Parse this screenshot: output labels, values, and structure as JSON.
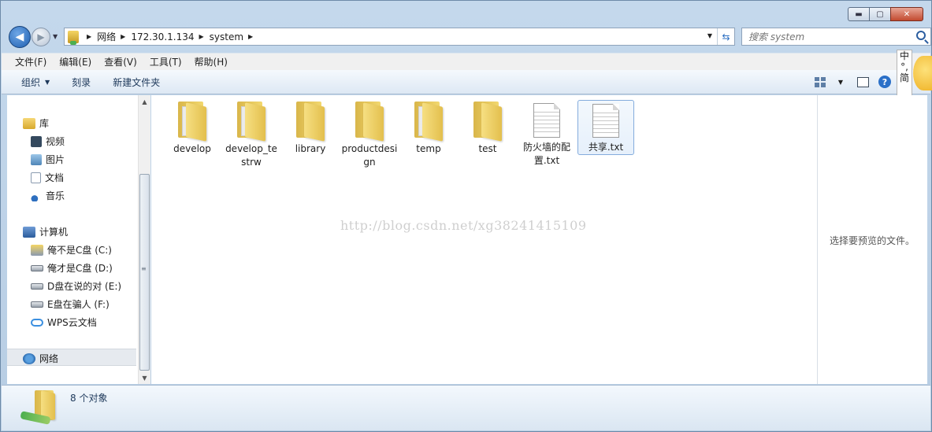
{
  "window": {
    "caption": {
      "minimize": "▬",
      "maximize": "▢",
      "close": "✕"
    }
  },
  "nav": {
    "back_glyph": "◀",
    "forward_glyph": "▶",
    "address": {
      "crumbs": [
        "网络",
        "172.30.1.134",
        "system"
      ],
      "separator": "▶",
      "dropdown": "▼",
      "refresh_glyph": "⇆"
    },
    "search": {
      "placeholder": "搜索 system"
    }
  },
  "menubar": {
    "items": [
      "文件(F)",
      "编辑(E)",
      "查看(V)",
      "工具(T)",
      "帮助(H)"
    ]
  },
  "toolbar": {
    "organize": "组织",
    "burn": "刻录",
    "new_folder": "新建文件夹",
    "dropdown": "▼",
    "help": "?"
  },
  "ime": {
    "chars": [
      "中",
      "°,",
      "简"
    ]
  },
  "navpane": {
    "library": {
      "label": "库",
      "items": [
        "视频",
        "图片",
        "文档",
        "音乐"
      ]
    },
    "computer": {
      "label": "计算机",
      "items": [
        "俺不是C盘 (C:)",
        "俺才是C盘 (D:)",
        "D盘在说的对 (E:)",
        "E盘在骗人 (F:)",
        "WPS云文档"
      ]
    },
    "network": {
      "label": "网络"
    }
  },
  "scroll": {
    "up": "▲",
    "down": "▼",
    "grip": "≡"
  },
  "files": [
    {
      "name": "develop",
      "type": "folder"
    },
    {
      "name": "develop_testrw",
      "type": "folder"
    },
    {
      "name": "library",
      "type": "folder"
    },
    {
      "name": "productdesign",
      "type": "folder"
    },
    {
      "name": "temp",
      "type": "folder"
    },
    {
      "name": "test",
      "type": "folder"
    },
    {
      "name": "防火墙的配置.txt",
      "type": "txt"
    },
    {
      "name": "共享.txt",
      "type": "txt",
      "selected": true
    }
  ],
  "watermark": "http://blog.csdn.net/xg38241415109",
  "preview": {
    "message": "选择要预览的文件。"
  },
  "details": {
    "count_text": "8 个对象"
  }
}
